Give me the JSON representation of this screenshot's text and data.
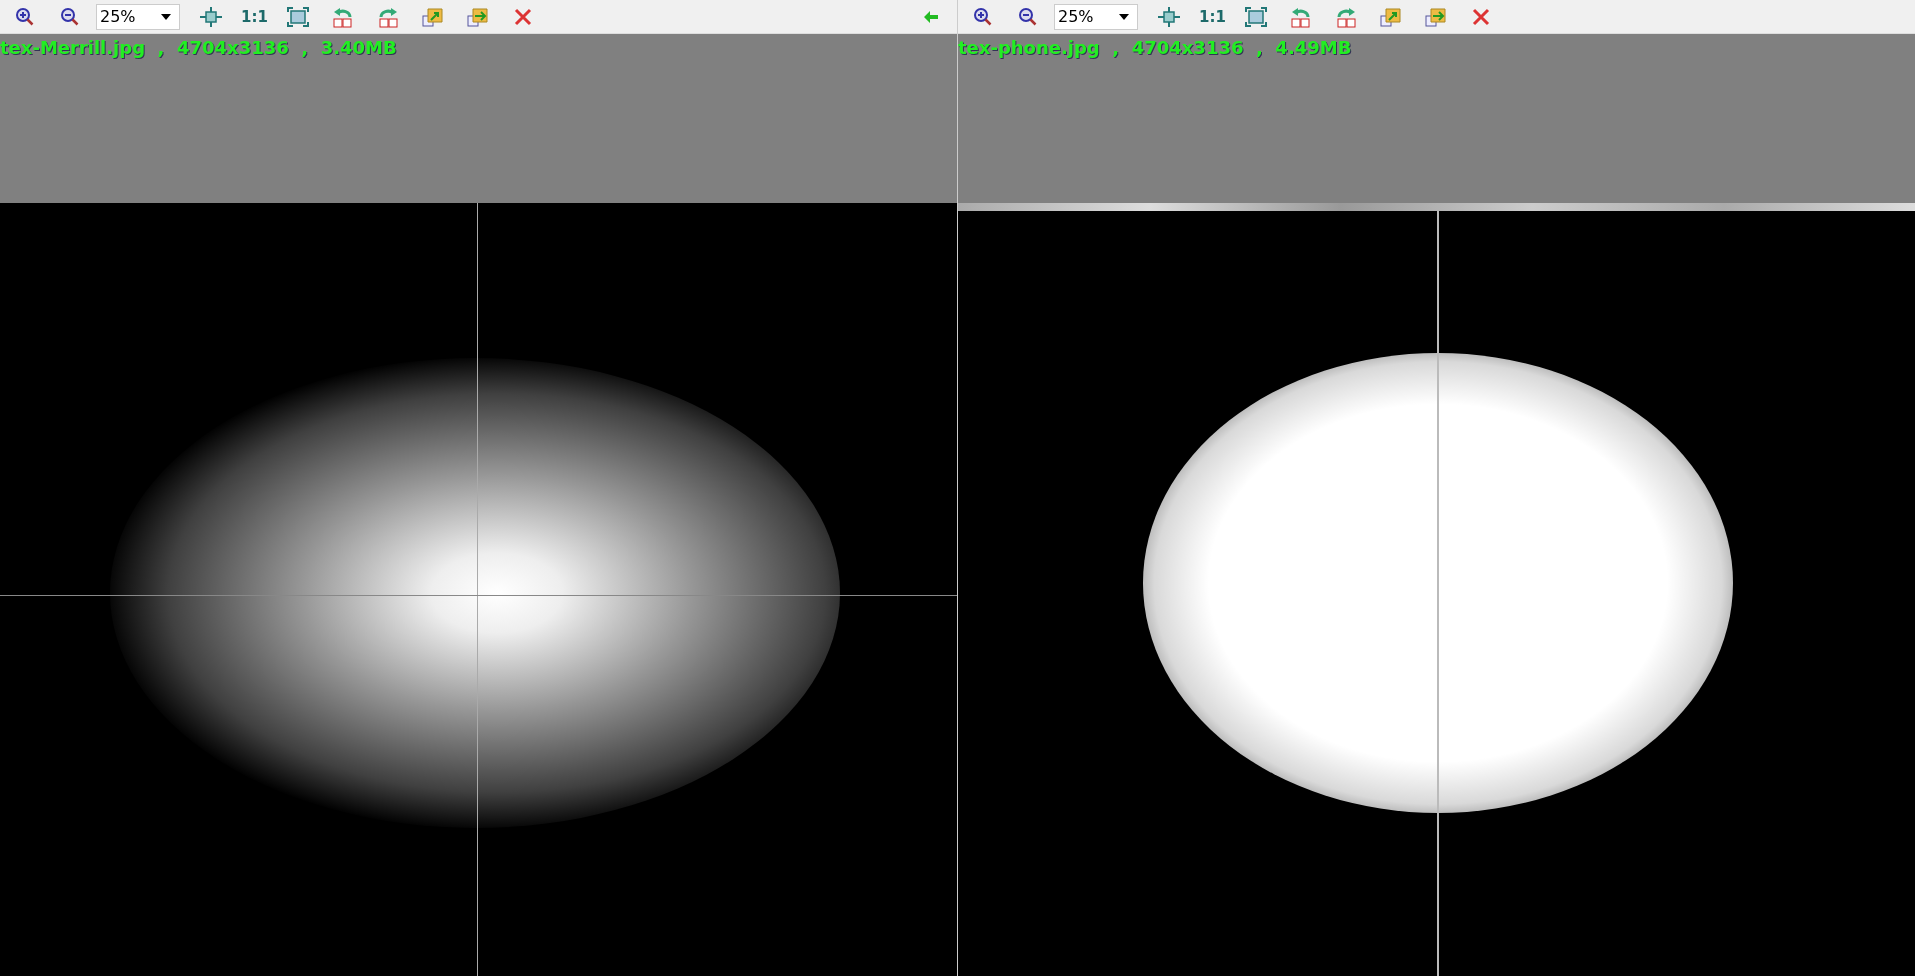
{
  "panes": [
    {
      "zoom": "25%",
      "one_to_one": "1:1",
      "info": "tex-Merrill.jpg  ,  4704x3136  ,  3.40MB"
    },
    {
      "zoom": "25%",
      "one_to_one": "1:1",
      "info": "tex-phone.jpg  ,  4704x3136  ,  4.49MB"
    }
  ]
}
